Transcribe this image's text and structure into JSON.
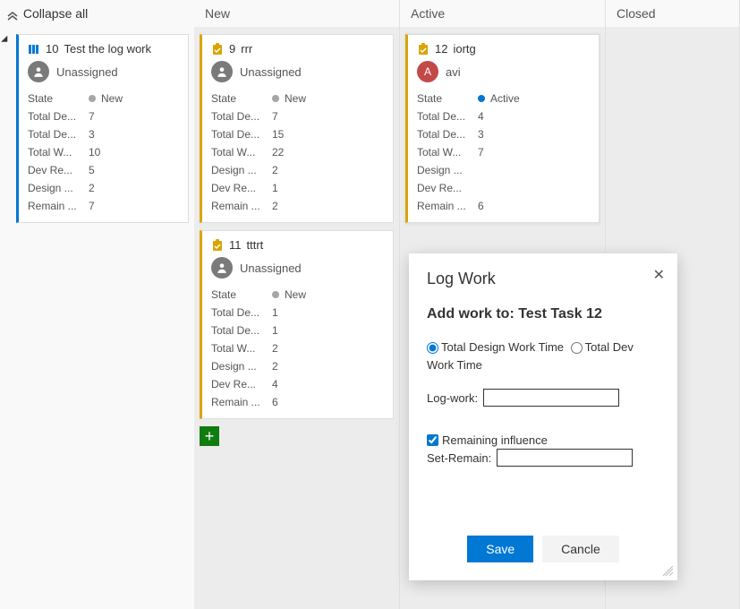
{
  "toolbar": {
    "collapse_label": "Collapse all"
  },
  "columns": {
    "backlog": "",
    "new": "New",
    "active": "Active",
    "closed": "Closed"
  },
  "cards": {
    "c10": {
      "id": "10",
      "title": "Test the log work",
      "assigned": "Unassigned",
      "state_label": "State",
      "state_val": "New",
      "f1k": "Total De...",
      "f1v": "7",
      "f2k": "Total De...",
      "f2v": "3",
      "f3k": "Total W...",
      "f3v": "10",
      "f4k": "Dev Re...",
      "f4v": "5",
      "f5k": "Design ...",
      "f5v": "2",
      "f6k": "Remain ...",
      "f6v": "7"
    },
    "c9": {
      "id": "9",
      "title": "rrr",
      "assigned": "Unassigned",
      "state_label": "State",
      "state_val": "New",
      "f1k": "Total De...",
      "f1v": "7",
      "f2k": "Total De...",
      "f2v": "15",
      "f3k": "Total W...",
      "f3v": "22",
      "f4k": "Design ...",
      "f4v": "2",
      "f5k": "Dev Re...",
      "f5v": "1",
      "f6k": "Remain ...",
      "f6v": "2"
    },
    "c11": {
      "id": "11",
      "title": "tttrt",
      "assigned": "Unassigned",
      "state_label": "State",
      "state_val": "New",
      "f1k": "Total De...",
      "f1v": "1",
      "f2k": "Total De...",
      "f2v": "1",
      "f3k": "Total W...",
      "f3v": "2",
      "f4k": "Design ...",
      "f4v": "2",
      "f5k": "Dev Re...",
      "f5v": "4",
      "f6k": "Remain ...",
      "f6v": "6"
    },
    "c12": {
      "id": "12",
      "title": "iortg",
      "assigned": "avi",
      "avatar": "A",
      "state_label": "State",
      "state_val": "Active",
      "f1k": "Total De...",
      "f1v": "4",
      "f2k": "Total De...",
      "f2v": "3",
      "f3k": "Total W...",
      "f3v": "7",
      "f4k": "Design ...",
      "f4v": "",
      "f5k": "Dev Re...",
      "f5v": "",
      "f6k": "Remain ...",
      "f6v": "6"
    }
  },
  "dialog": {
    "title": "Log Work",
    "sub_prefix": "Add work to: ",
    "sub_task": "Test Task 12",
    "radio_design": "Total Design Work Time",
    "radio_dev": "Total Dev Work Time",
    "logwork_label": "Log-work:",
    "logwork_value": "",
    "remain_check": "Remaining influence",
    "remain_label": "Set-Remain:",
    "remain_value": "",
    "save": "Save",
    "cancel": "Cancle"
  }
}
